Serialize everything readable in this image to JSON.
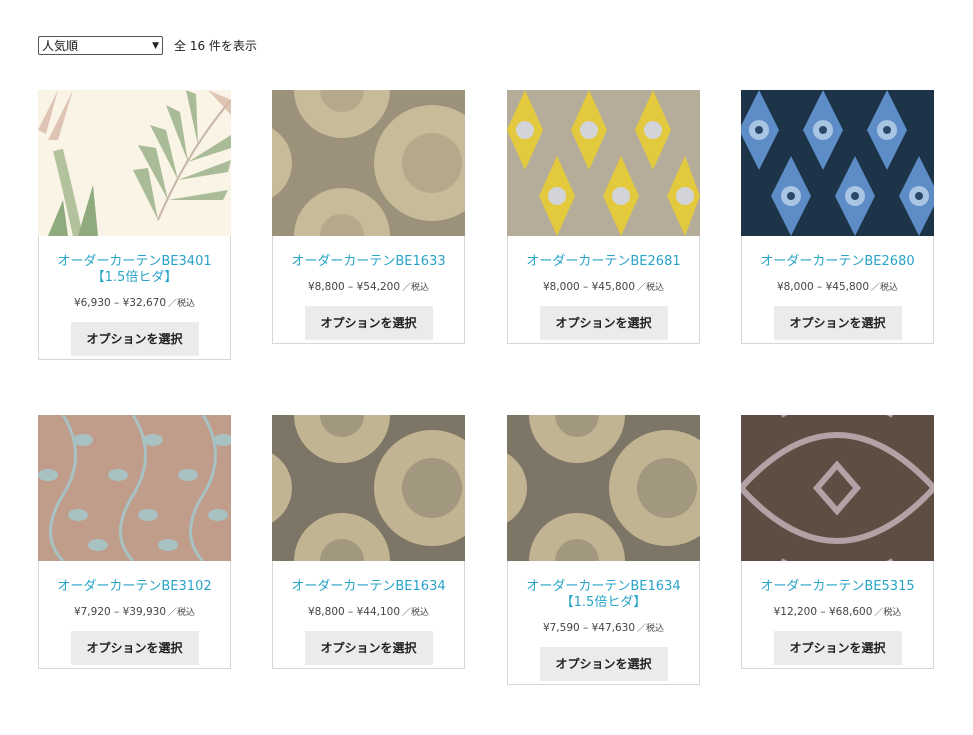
{
  "sort": {
    "selected": "人気順"
  },
  "result_count": "全 16 件を表示",
  "products": [
    {
      "name": "オーダーカーテンBE3401【1.5倍ヒダ】",
      "price_range": "¥6,930 – ¥32,670",
      "tax": "／税込",
      "button": "オプションを選択"
    },
    {
      "name": "オーダーカーテンBE1633",
      "price_range": "¥8,800 – ¥54,200",
      "tax": "／税込",
      "button": "オプションを選択"
    },
    {
      "name": "オーダーカーテンBE2681",
      "price_range": "¥8,000 – ¥45,800",
      "tax": "／税込",
      "button": "オプションを選択"
    },
    {
      "name": "オーダーカーテンBE2680",
      "price_range": "¥8,000 – ¥45,800",
      "tax": "／税込",
      "button": "オプションを選択"
    },
    {
      "name": "オーダーカーテンBE3102",
      "price_range": "¥7,920 – ¥39,930",
      "tax": "／税込",
      "button": "オプションを選択"
    },
    {
      "name": "オーダーカーテンBE1634",
      "price_range": "¥8,800 – ¥44,100",
      "tax": "／税込",
      "button": "オプションを選択"
    },
    {
      "name": "オーダーカーテンBE1634【1.5倍ヒダ】",
      "price_range": "¥7,590 – ¥47,630",
      "tax": "／税込",
      "button": "オプションを選択"
    },
    {
      "name": "オーダーカーテンBE5315",
      "price_range": "¥12,200 – ¥68,600",
      "tax": "／税込",
      "button": "オプションを選択"
    }
  ],
  "colors": {
    "link": "#27a3c8",
    "button_bg": "#ebebeb",
    "card_border": "#d7d7d7"
  }
}
